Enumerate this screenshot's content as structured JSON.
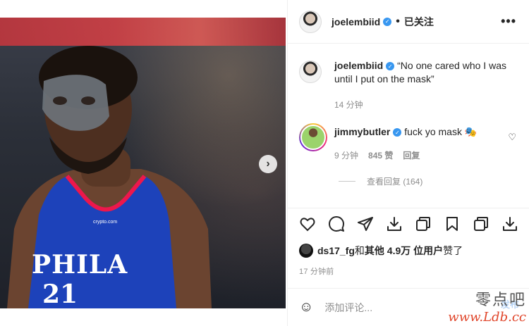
{
  "photo": {
    "next_arrow": "›",
    "jersey_text": "PHILA",
    "jersey_number": "21",
    "sponsor": "crypto.com"
  },
  "header": {
    "username": "joelembiid",
    "dot": "•",
    "follow_state": "已关注",
    "more": "•••"
  },
  "caption": {
    "username": "joelembiid",
    "text": "“No one cared who I was until I put on the mask”",
    "time": "14 分钟"
  },
  "comment": {
    "username": "jimmybutler",
    "text": "fuck yo mask 🎭",
    "time": "9 分钟",
    "likes": "845 赞",
    "reply": "回复"
  },
  "view_replies": "查看回复 (164)",
  "likes": {
    "user": "ds17_fg",
    "and": " 和 ",
    "others": "其他 4.9万 位用户",
    "liked": " 赞了"
  },
  "timestamp": "17 分钟前",
  "add_comment": {
    "placeholder": "添加评论..."
  },
  "watermark": {
    "cn": "零点吧",
    "url": "www.Ldb.cc",
    "publish": "发布"
  },
  "colors": {
    "verified": "#3897f0",
    "meta_gray": "#8e8e8e",
    "border": "#efefef"
  }
}
